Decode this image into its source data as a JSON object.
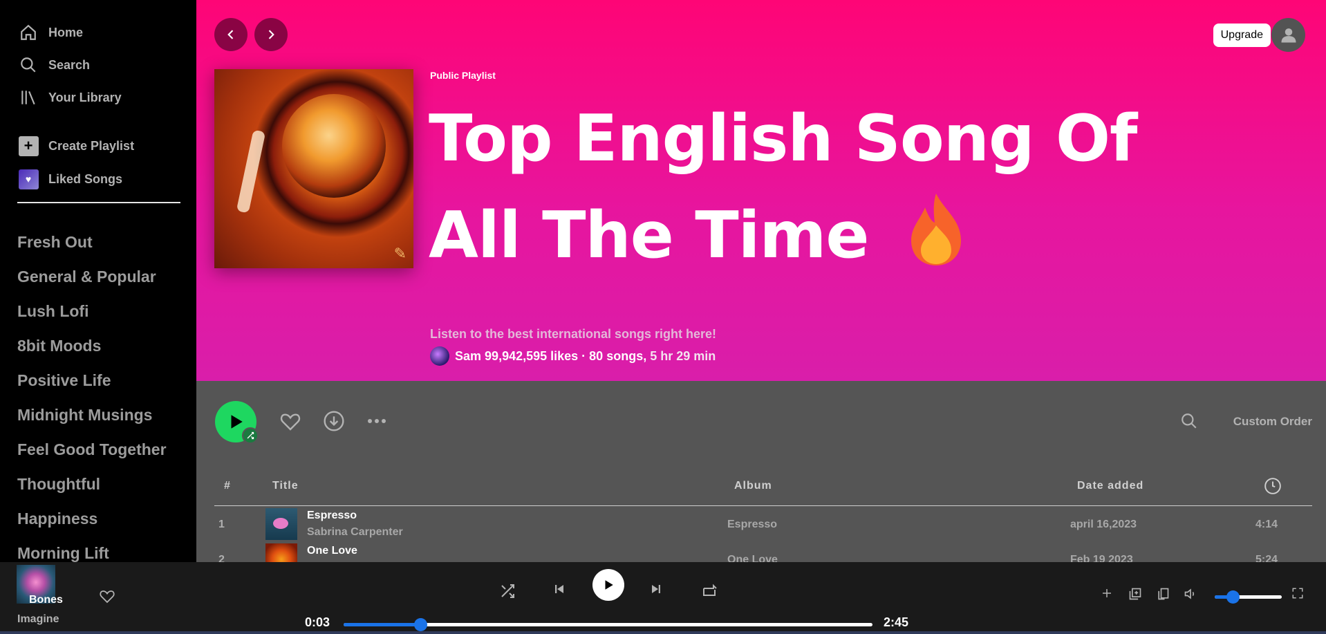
{
  "sidebar": {
    "nav": [
      {
        "label": "Home",
        "icon": "home-icon"
      },
      {
        "label": "Search",
        "icon": "search-icon"
      },
      {
        "label": "Your Library",
        "icon": "library-icon"
      }
    ],
    "create_playlist": "Create Playlist",
    "liked_songs": "Liked Songs",
    "playlists": [
      "Fresh Out",
      "General & Popular",
      "Lush Lofi",
      "8bit Moods",
      "Positive Life",
      "Midnight Musings",
      "Feel Good Together",
      "Thoughtful",
      "Happiness",
      "Morning Lift"
    ]
  },
  "header": {
    "upgrade_label": "Upgrade"
  },
  "playlist": {
    "type": "Public Playlist",
    "title": "Top English Song Of All The Time",
    "description": "Listen to the best international songs right here!",
    "owner": "Sam",
    "likes": "99,942,595 likes",
    "separator": " · ",
    "songs": "80 songs,",
    "duration": " 5 hr 29 min"
  },
  "actions": {
    "sort_label": "Custom Order"
  },
  "table": {
    "headers": {
      "num": "#",
      "title": "Title",
      "album": "Album",
      "date": "Date added"
    },
    "rows": [
      {
        "num": "1",
        "title": "Espresso",
        "artist": "Sabrina Carpenter",
        "album": "Espresso",
        "date": "april 16,2023",
        "duration": "4:14"
      },
      {
        "num": "2",
        "title": "One Love",
        "artist": "",
        "album": "One Love",
        "date": "Feb 19 2023",
        "duration": "5:24"
      }
    ]
  },
  "player": {
    "title": "Bones",
    "artist": "Imagine",
    "current_time": "0:03",
    "total_time": "2:45",
    "progress": 0.145,
    "volume": 0.27
  },
  "colors": {
    "accent": "#1ed760",
    "progress": "#1a73e8",
    "hero_top": "#fe0576",
    "hero_bottom": "#d91eaa"
  }
}
